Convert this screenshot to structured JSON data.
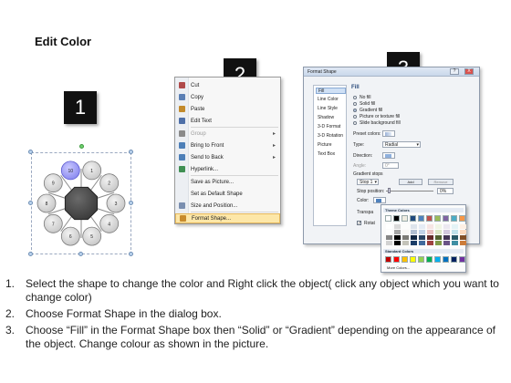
{
  "title": "Edit Color",
  "steps": {
    "one": "1",
    "two": "2",
    "three": "3"
  },
  "diagram": {
    "center_label": "",
    "selected_node": "10",
    "nodes": [
      "1",
      "2",
      "3",
      "4",
      "5",
      "6",
      "7",
      "8",
      "9",
      "10"
    ],
    "selected_color": "#8d8cf0",
    "node_color": "#c9c9c9",
    "center_color": "#3a3a3a"
  },
  "context_menu": {
    "items": [
      {
        "label": "Cut",
        "disabled": false,
        "submenu": false,
        "icon": "scissors-icon"
      },
      {
        "label": "Copy",
        "disabled": false,
        "submenu": false,
        "icon": "copy-icon"
      },
      {
        "label": "Paste",
        "disabled": false,
        "submenu": false,
        "icon": "paste-icon"
      },
      {
        "label": "Edit Text",
        "disabled": false,
        "submenu": false,
        "icon": "edit-text-icon"
      },
      {
        "label": "Group",
        "disabled": true,
        "submenu": true,
        "icon": "group-icon"
      },
      {
        "label": "Bring to Front",
        "disabled": false,
        "submenu": true,
        "icon": "bring-front-icon"
      },
      {
        "label": "Send to Back",
        "disabled": false,
        "submenu": true,
        "icon": "send-back-icon"
      },
      {
        "label": "Hyperlink...",
        "disabled": false,
        "submenu": false,
        "icon": "hyperlink-icon"
      },
      {
        "label": "Save as Picture...",
        "disabled": false,
        "submenu": false,
        "icon": ""
      },
      {
        "label": "Set as Default Shape",
        "disabled": false,
        "submenu": false,
        "icon": ""
      },
      {
        "label": "Size and Position...",
        "disabled": false,
        "submenu": false,
        "icon": "size-position-icon"
      },
      {
        "label": "Format Shape...",
        "disabled": false,
        "submenu": false,
        "icon": "format-shape-icon",
        "highlighted": true
      }
    ]
  },
  "dialog": {
    "title": "Format Shape",
    "controls": {
      "help": "?",
      "close": "X"
    },
    "nav": [
      "Fill",
      "Line Color",
      "Line Style",
      "Shadow",
      "3-D Format",
      "3-D Rotation",
      "Picture",
      "Text Box"
    ],
    "selected_nav": "Fill",
    "heading": "Fill",
    "fill_options": [
      "No fill",
      "Solid fill",
      "Gradient fill",
      "Picture or texture fill",
      "Slide background fill"
    ],
    "selected_fill": "Gradient fill",
    "preset_label": "Preset colors:",
    "type_label": "Type:",
    "type_value": "Radial",
    "direction_label": "Direction:",
    "angle_label": "Angle:",
    "angle_value": "0°",
    "stops_label": "Gradient stops",
    "stop_value": "Stop 1",
    "add_label": "Add",
    "remove_label": "Remove",
    "position_label": "Stop position:",
    "position_value": "0%",
    "color_label": "Color:",
    "transparency_label": "Transpa",
    "rotate_label": "Rotat"
  },
  "palette": {
    "theme_heading": "Theme Colors",
    "standard_heading": "Standard Colors",
    "more_label": "More Colors...",
    "theme_colors": [
      "#ffffff",
      "#000000",
      "#eeece1",
      "#1f497d",
      "#4f81bd",
      "#c0504d",
      "#9bbb59",
      "#8064a2",
      "#4bacc6",
      "#f79646"
    ],
    "standard_colors": [
      "#c00000",
      "#ff0000",
      "#ffc000",
      "#ffff00",
      "#92d050",
      "#00b050",
      "#00b0f0",
      "#0070c0",
      "#002060",
      "#7030a0"
    ]
  },
  "instructions": [
    {
      "num": "1.",
      "text": "Select the shape to change the color and Right click the object( click any object which you want to change color)"
    },
    {
      "num": "2.",
      "text": "Choose Format Shape in the dialog box."
    },
    {
      "num": "3.",
      "text": "Choose “Fill” in the Format Shape box then “Solid” or “Gradient” depending on the appearance of the object. Change colour as shown in the picture."
    }
  ]
}
